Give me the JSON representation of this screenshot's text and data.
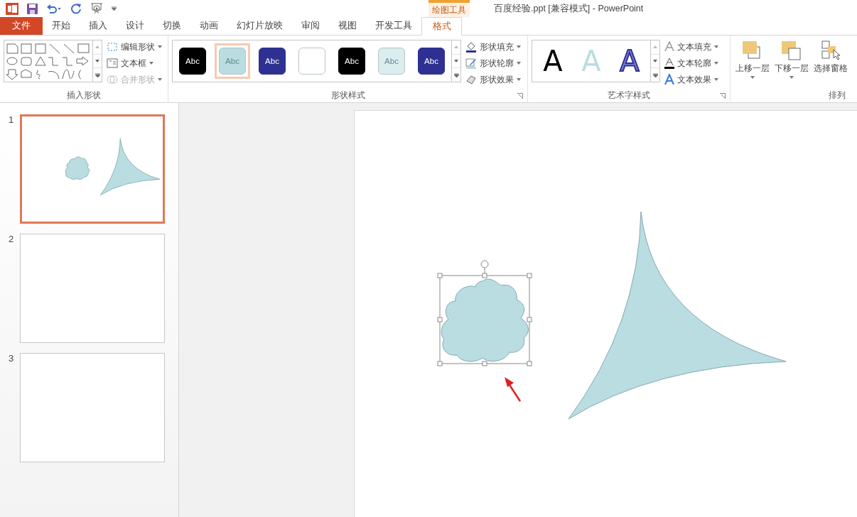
{
  "window": {
    "title": "百度经验.ppt [兼容模式] - PowerPoint",
    "context_group": "绘图工具"
  },
  "tabs": [
    {
      "label": "文件",
      "kind": "file",
      "selected": false
    },
    {
      "label": "开始",
      "kind": "normal",
      "selected": false
    },
    {
      "label": "插入",
      "kind": "normal",
      "selected": false
    },
    {
      "label": "设计",
      "kind": "normal",
      "selected": false
    },
    {
      "label": "切换",
      "kind": "normal",
      "selected": false
    },
    {
      "label": "动画",
      "kind": "normal",
      "selected": false
    },
    {
      "label": "幻灯片放映",
      "kind": "normal",
      "selected": false
    },
    {
      "label": "审阅",
      "kind": "normal",
      "selected": false
    },
    {
      "label": "视图",
      "kind": "normal",
      "selected": false
    },
    {
      "label": "开发工具",
      "kind": "normal",
      "selected": false
    },
    {
      "label": "格式",
      "kind": "context",
      "selected": true
    }
  ],
  "ribbon": {
    "insert_shapes": {
      "label": "插入形状",
      "buttons": [
        {
          "label": "编辑形状",
          "disabled": false
        },
        {
          "label": "文本框",
          "disabled": false
        },
        {
          "label": "合并形状",
          "disabled": true
        }
      ]
    },
    "shape_styles": {
      "label": "形状样式",
      "swatches": [
        {
          "label": "Abc",
          "color": "#000000",
          "kind": "dark",
          "selected": false
        },
        {
          "label": "Abc",
          "color": "#b9dde1",
          "kind": "faded",
          "selected": true
        },
        {
          "label": "Abc",
          "color": "#2e3192",
          "kind": "dark",
          "selected": false
        },
        {
          "color": "#ffffff",
          "kind": "outline",
          "selected": false
        },
        {
          "label": "Abc",
          "color": "#000000",
          "kind": "dark",
          "selected": false
        },
        {
          "label": "Abc",
          "color": "#daedef",
          "kind": "faded",
          "selected": false
        },
        {
          "label": "Abc",
          "color": "#2e3192",
          "kind": "dark",
          "selected": false
        }
      ],
      "buttons": [
        {
          "label": "形状填充",
          "kind": "fill"
        },
        {
          "label": "形状轮廓",
          "kind": "outline"
        },
        {
          "label": "形状效果",
          "kind": "effect"
        }
      ]
    },
    "wordart": {
      "label": "艺术字样式",
      "letters": [
        {
          "label": "A",
          "kind": "black"
        },
        {
          "label": "A",
          "kind": "pale"
        },
        {
          "label": "A",
          "kind": "outlined"
        }
      ],
      "buttons": [
        {
          "label": "文本填充",
          "kind": "fill"
        },
        {
          "label": "文本轮廓",
          "kind": "outline"
        },
        {
          "label": "文本效果",
          "kind": "effect"
        }
      ]
    },
    "arrange": {
      "label": "排列",
      "buttons": [
        {
          "label": "上移一层",
          "kind": "forward"
        },
        {
          "label": "下移一层",
          "kind": "backward"
        },
        {
          "label": "选择窗格",
          "kind": "pane"
        }
      ]
    }
  },
  "slides": [
    {
      "number": "1",
      "selected": true,
      "kind": "shapes"
    },
    {
      "number": "2",
      "selected": false,
      "kind": "blank"
    },
    {
      "number": "3",
      "selected": false,
      "kind": "blank"
    }
  ],
  "canvas": {
    "shapes": [
      {
        "kind": "blob",
        "selected": true
      },
      {
        "kind": "triangle",
        "selected": false
      }
    ],
    "annotation": {
      "kind": "arrow"
    }
  }
}
